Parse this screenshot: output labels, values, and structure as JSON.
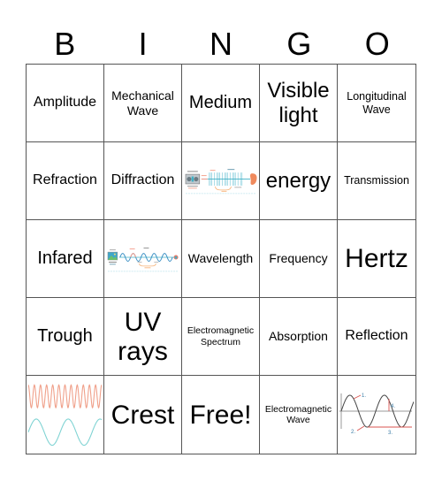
{
  "header": {
    "letters": [
      "B",
      "I",
      "N",
      "G",
      "O"
    ]
  },
  "board": {
    "rows": [
      [
        {
          "type": "text",
          "text": "Amplitude"
        },
        {
          "type": "text",
          "text": "Mechanical Wave"
        },
        {
          "type": "text",
          "text": "Medium"
        },
        {
          "type": "text",
          "text": "Visible light"
        },
        {
          "type": "text",
          "text": "Longitudinal Wave"
        }
      ],
      [
        {
          "type": "text",
          "text": "Refraction"
        },
        {
          "type": "text",
          "text": "Diffraction"
        },
        {
          "type": "image",
          "icon": "sound-wave-diagram-icon",
          "description": "speaker emitting compression waves toward an ear"
        },
        {
          "type": "text",
          "text": "energy"
        },
        {
          "type": "text",
          "text": "Transmission"
        }
      ],
      [
        {
          "type": "text",
          "text": "Infared"
        },
        {
          "type": "image",
          "icon": "electromagnetic-wave-diagram-icon",
          "description": "screen emitting a transverse wave toward a receiver"
        },
        {
          "type": "text",
          "text": "Wavelength"
        },
        {
          "type": "text",
          "text": "Frequency"
        },
        {
          "type": "text",
          "text": "Hertz"
        }
      ],
      [
        {
          "type": "text",
          "text": "Trough"
        },
        {
          "type": "text",
          "text": "UV rays"
        },
        {
          "type": "text",
          "text": "Electromagnetic Spectrum"
        },
        {
          "type": "text",
          "text": "Absorption"
        },
        {
          "type": "text",
          "text": "Reflection"
        }
      ],
      [
        {
          "type": "image",
          "icon": "high-low-frequency-waves-icon",
          "description": "high frequency orange wave above low frequency teal wave"
        },
        {
          "type": "text",
          "text": "Crest"
        },
        {
          "type": "text",
          "text": "Free!"
        },
        {
          "type": "text",
          "text": "Electromagnetic Wave"
        },
        {
          "type": "image",
          "icon": "labeled-wave-parts-icon",
          "description": "sine wave with numbered labels",
          "labels": [
            "1.",
            "2.",
            "3.",
            "4."
          ]
        }
      ]
    ]
  },
  "colors": {
    "grid_line": "#555555",
    "wave_orange": "#f0a08a",
    "wave_teal": "#7fd3d3",
    "label_blue": "#3a7ca5",
    "pointer_red": "#d9534f"
  }
}
